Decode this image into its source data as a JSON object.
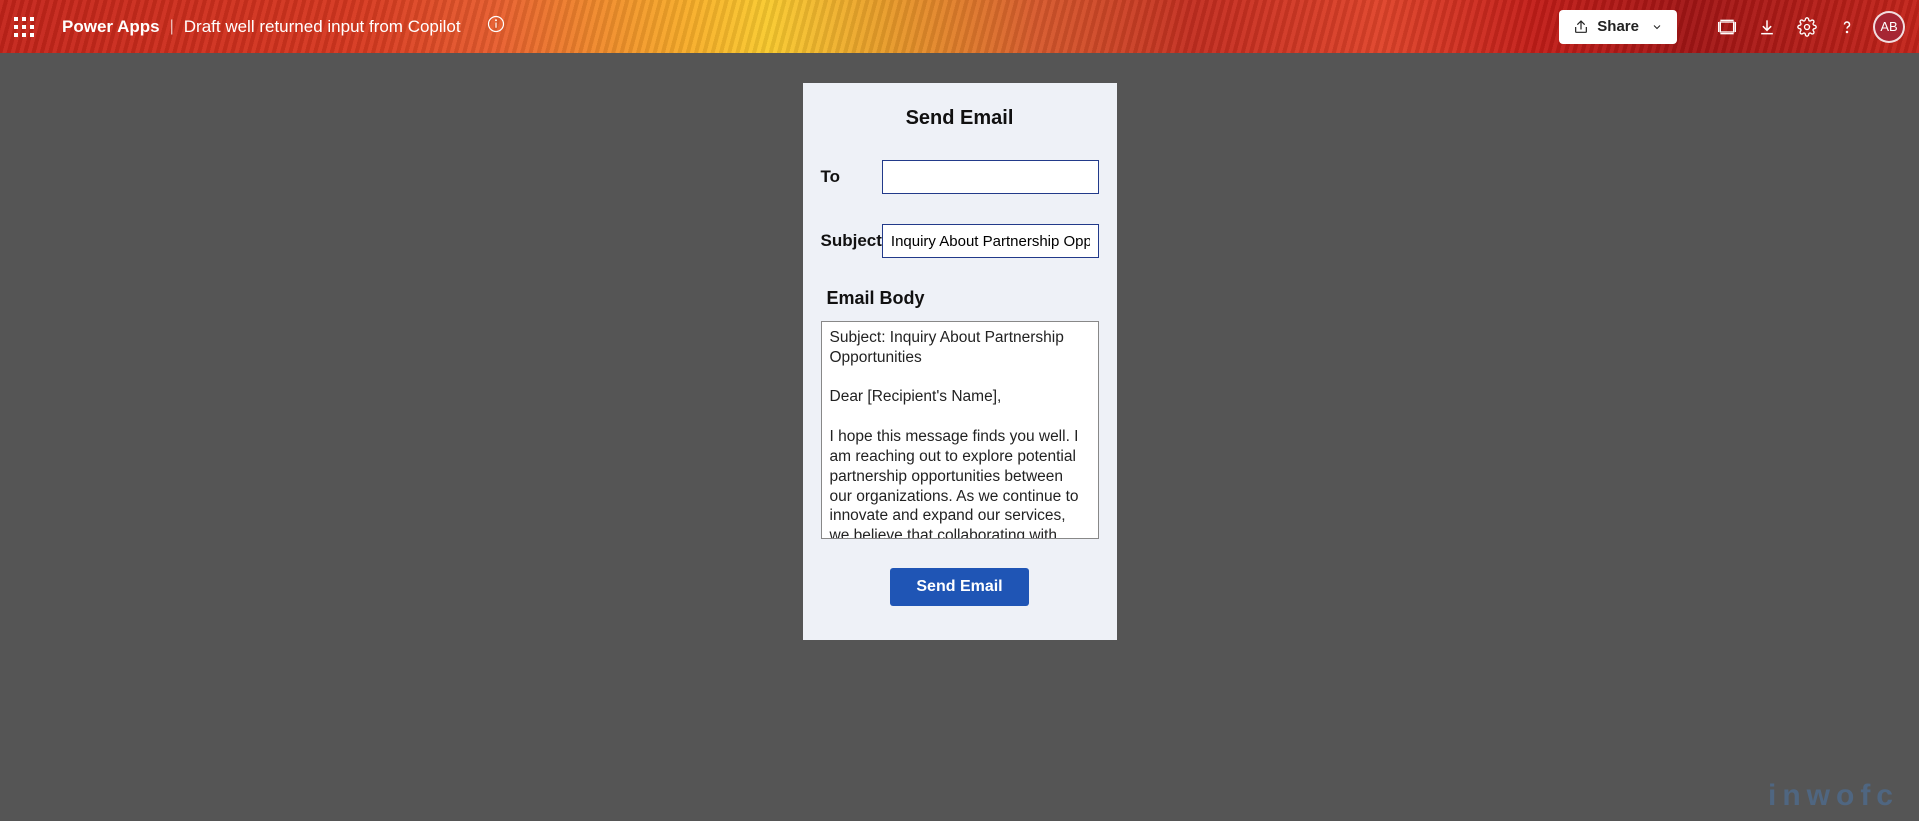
{
  "header": {
    "brand": "Power Apps",
    "separator": "|",
    "title": "Draft well returned input from Copilot",
    "share_label": "Share",
    "avatar_initials": "AB"
  },
  "form": {
    "title": "Send Email",
    "to_label": "To",
    "to_value": "",
    "subject_label": "Subject",
    "subject_value": "Inquiry About Partnership Opportunities",
    "body_label": "Email Body",
    "body_value": "Subject: Inquiry About Partnership Opportunities\n\nDear [Recipient's Name],\n\nI hope this message finds you well. I am reaching out to explore potential partnership opportunities between our organizations. As we continue to innovate and expand our services, we believe that collaborating with like-minded entities can lead to mutually beneficial outcomes.",
    "send_label": "Send Email"
  },
  "watermark": "inwofc"
}
